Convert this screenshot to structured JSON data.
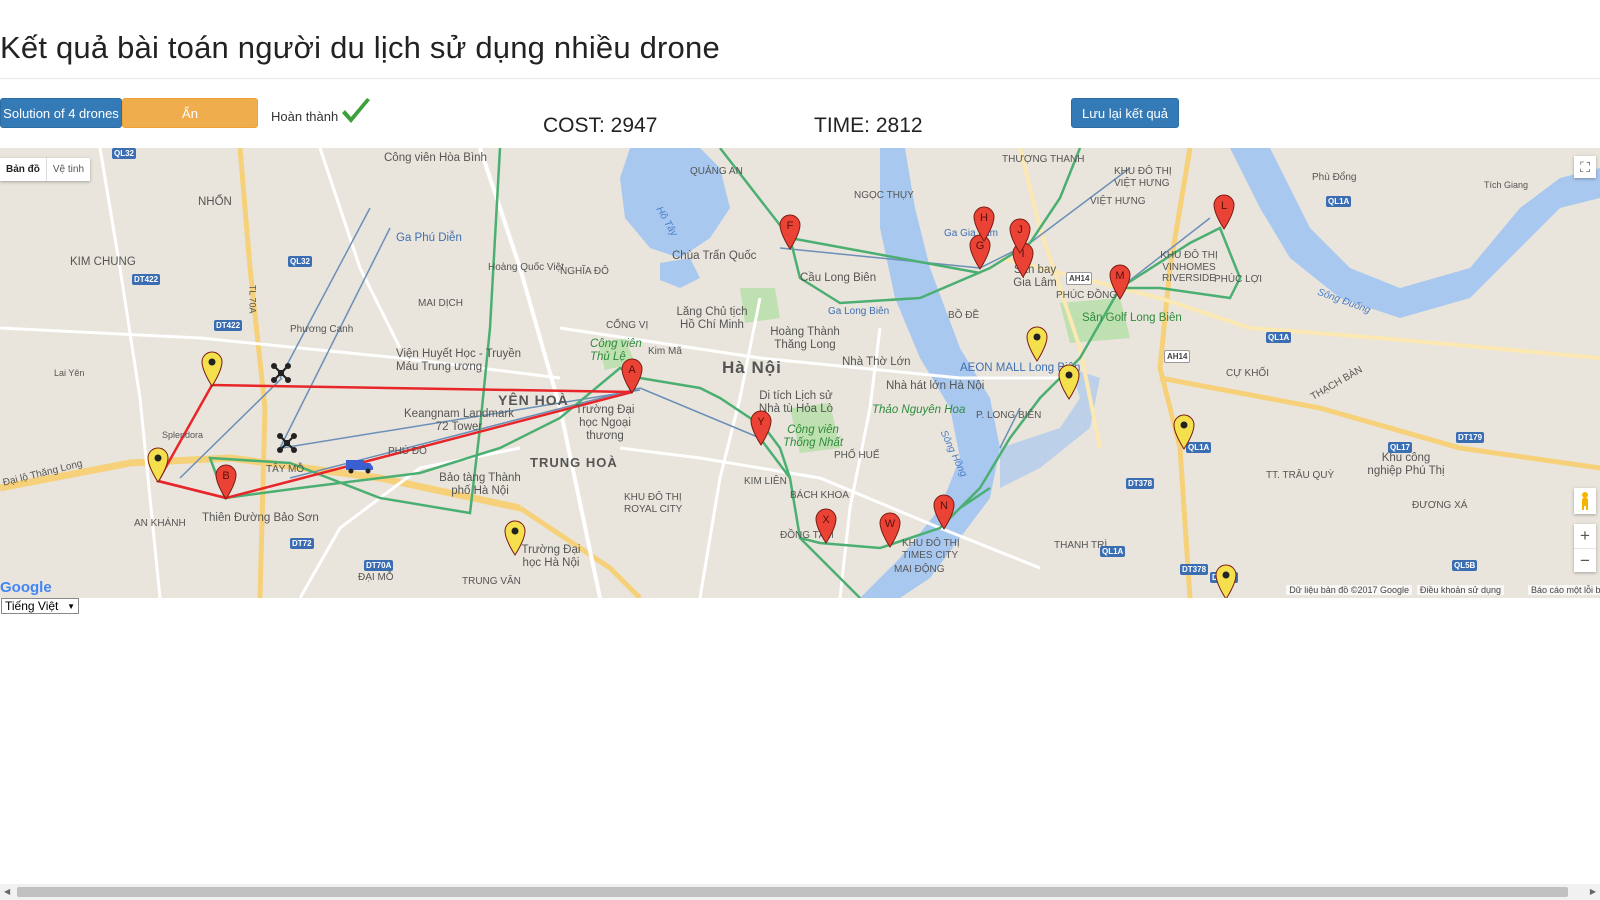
{
  "page": {
    "title": "Kết quả bài toán người du lịch sử dụng nhiều drone"
  },
  "toolbar": {
    "solution_label": "Solution of 4 drones",
    "hide_label": "Ẩn",
    "status_label": "Hoàn thành",
    "cost_label": "COST: 2947",
    "time_label": "TIME: 2812",
    "save_label": "Lưu lại kết quả"
  },
  "map": {
    "map_type_map": "Bản đồ",
    "map_type_satellite": "Vệ tinh",
    "logo": "Google",
    "attribution_data": "Dữ liệu bản đồ ©2017 Google",
    "attribution_terms": "Điều khoản sử dụng",
    "attribution_report": "Báo cáo một lỗi bản đồ",
    "zoom_in": "+",
    "zoom_out": "−",
    "fullscreen": "⛶",
    "colors": {
      "truck_route": "#4caf72",
      "drone_route": "#e8262a",
      "drone_leg": "#6b8fb8",
      "marker_red": "#ea4335",
      "marker_yellow": "#f4e04d"
    },
    "places": [
      "Công viên Hòa Bình",
      "NHỔN",
      "KIM CHUNG",
      "Ga Phú Diễn",
      "Hoàng Quốc Việt",
      "NGHĨA ĐÔ",
      "MAI DỊCH",
      "Phương Canh",
      "CỔNG VỊ",
      "Công viên Thủ Lệ",
      "Kim Mã",
      "Viện Huyết Học - Truyền Máu Trung ương",
      "YÊN HOÀ",
      "Keangnam Landmark 72 Tower",
      "Trường Đại học Ngoại thương",
      "TRUNG HOÀ",
      "Bảo tàng Thành phố Hà Nội",
      "PHÚ ĐÔ",
      "TÂY MỖ",
      "Thiên Đường Bảo Sơn",
      "AN KHÁNH",
      "Trường Đại học Hà Nội",
      "ĐẠI MỖ",
      "TRUNG VĂN",
      "KHU ĐÔ THỊ ROYAL CITY",
      "Chùa Trấn Quốc",
      "QUẢNG AN",
      "Hồ Tây",
      "Lăng Chủ tịch Hồ Chí Minh",
      "Hoàng Thành Thăng Long",
      "Hà Nội",
      "Nhà Thờ Lớn",
      "Nhà hát lớn Hà Nội",
      "Di tích Lịch sử Nhà tù Hỏa Lò",
      "Thảo Nguyên Hoa",
      "Công viên Thống Nhất",
      "PHỐ HUẾ",
      "KIM LIÊN",
      "BÁCH KHOA",
      "ĐỒNG TÂM",
      "KHU ĐÔ THỊ TIMES CITY",
      "MAI ĐỘNG",
      "Cầu Long Biên",
      "Ga Long Biên",
      "NGỌC THỤY",
      "THƯỢNG THANH",
      "KHU ĐÔ THỊ VIỆT HƯNG",
      "VIỆT HƯNG",
      "Ga Gia Lâm",
      "Sân bay Gia Lâm",
      "PHÚC ĐỒNG",
      "BỒ ĐỀ",
      "Sân Golf Long Biên",
      "AEON MALL Long Biên",
      "P. LONG BIÊN",
      "KHU ĐÔ THỊ VINHOMES RIVERSIDE",
      "PHÚC LỢI",
      "Phù Đổng",
      "Sông Đuống",
      "THẠCH BÀN",
      "CỰ KHỐI",
      "THANH TRÌ",
      "Khu công nghiệp Phú Thị",
      "ĐƯƠNG XÁ",
      "TT. TRÂU QUỲ",
      "Sông Hồng",
      "Đại lộ Thăng Long",
      "Splendora",
      "Lai Yên",
      "Tích Giang"
    ],
    "shields": [
      "QL32",
      "QL32",
      "DT422",
      "DT422",
      "TL 70A",
      "DT72",
      "DT70A",
      "AH14",
      "AH14",
      "QL1A",
      "QL1A",
      "QL1A",
      "QL5B",
      "DT378",
      "DT378",
      "DT179",
      "QL17",
      "QL1A",
      "DT379"
    ],
    "markers_red": [
      "A",
      "B",
      "F",
      "G",
      "H",
      "I",
      "J",
      "L",
      "M",
      "N",
      "W",
      "X",
      "Y"
    ]
  },
  "footer": {
    "language_value": "Tiếng Việt"
  }
}
